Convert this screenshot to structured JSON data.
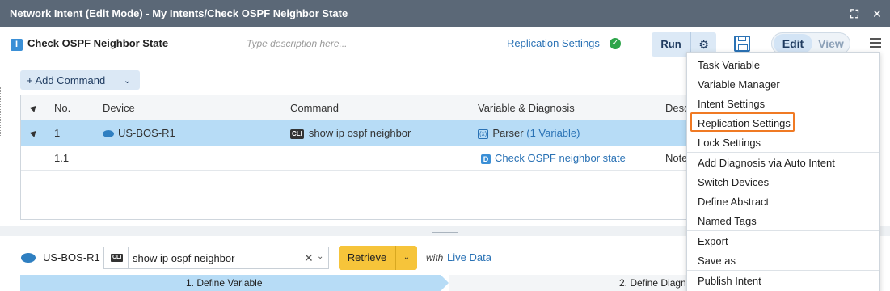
{
  "window": {
    "title": "Network Intent (Edit Mode) - My Intents/Check OSPF Neighbor State",
    "maximize_icon": "maximize-icon",
    "close_icon": "close-icon"
  },
  "header": {
    "intent_badge": "I",
    "intent_name": "Check OSPF Neighbor State",
    "description_placeholder": "Type description here...",
    "replication_label": "Replication Settings",
    "run_label": "Run",
    "edit_label": "Edit",
    "view_label": "View"
  },
  "commands": {
    "add_label": "+ Add Command",
    "columns": [
      "No.",
      "Device",
      "Command",
      "Variable & Diagnosis",
      "Desc"
    ],
    "rows": [
      {
        "no": "1",
        "device": "US-BOS-R1",
        "command": "show ip ospf neighbor",
        "var_prefix": "Parser",
        "var_link": "(1 Variable)",
        "desc": ""
      },
      {
        "no": "1.1",
        "device": "",
        "command": "",
        "var_link": "Check OSPF neighbor state",
        "desc": "Note"
      }
    ]
  },
  "bottom": {
    "device": "US-BOS-R1",
    "command": "show ip ospf neighbor",
    "retrieve_label": "Retrieve",
    "with_text": "with",
    "live_data_label": "Live Data",
    "steps": [
      "1. Define Variable",
      "2. Define Diagn"
    ]
  },
  "menu": {
    "items": [
      "Task Variable",
      "Variable Manager",
      "Intent Settings",
      "Replication Settings",
      "Lock Settings",
      "Add Diagnosis via Auto Intent",
      "Switch Devices",
      "Define Abstract",
      "Named Tags",
      "Export",
      "Save as",
      "Publish Intent"
    ],
    "highlighted": "Replication Settings"
  },
  "colors": {
    "titlebar": "#5b6877",
    "selected_row": "#b7dcf6",
    "link": "#2a72b5",
    "retrieve": "#f6c43a",
    "highlight_border": "#f07a24"
  }
}
